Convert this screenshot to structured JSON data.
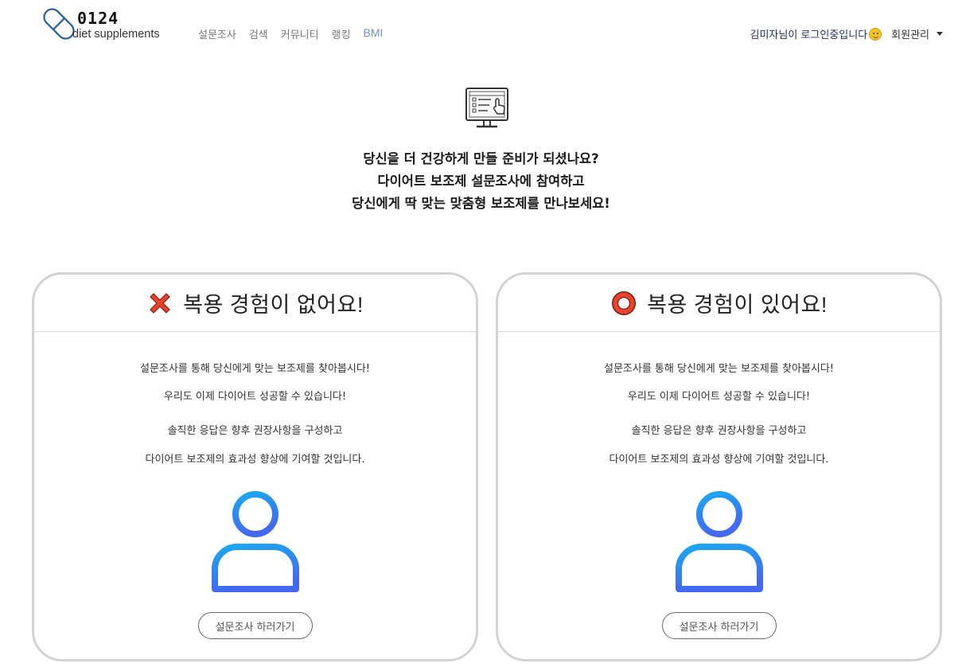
{
  "brand": {
    "number": "0124",
    "subtitle": "diet supplements",
    "icon": "pill-icon"
  },
  "nav": {
    "links": [
      {
        "label": "설문조사"
      },
      {
        "label": "검색"
      },
      {
        "label": "커뮤니티"
      },
      {
        "label": "랭킹"
      },
      {
        "label": "BMI"
      }
    ],
    "login_message": "김미자님이 로그인중입니다",
    "login_emoji": "smile-emoji",
    "member_menu": "회원관리"
  },
  "hero": {
    "icon": "survey-monitor-icon",
    "lines": [
      "당신을 더 건강하게 만들 준비가 되셨나요?",
      "다이어트 보조제 설문조사에 참여하고",
      "당신에게 딱 맞는 맞춤형 보조제를 만나보세요!"
    ]
  },
  "cards": [
    {
      "icon": "x-mark-icon",
      "title": "복용 경험이 없어요!",
      "lines": [
        "설문조사를 통해 당신에게 맞는 보조제를 찾아봅시다!",
        "우리도 이제 다이어트 성공할 수 있습니다!",
        "솔직한 응답은 향후 권장사항을 구성하고",
        "다이어트 보조제의 효과성 향상에 기여할 것입니다."
      ],
      "button": "설문조사 하러가기"
    },
    {
      "icon": "circle-mark-icon",
      "title": "복용 경험이 있어요!",
      "lines": [
        "설문조사를 통해 당신에게 맞는 보조제를 찾아봅시다!",
        "우리도 이제 다이어트 성공할 수 있습니다!",
        "솔직한 응답은 향후 권장사항을 구성하고",
        "다이어트 보조제의 효과성 향상에 기여할 것입니다."
      ],
      "button": "설문조사 하러가기"
    }
  ],
  "colors": {
    "nav_active": "#6d93c7",
    "login_text": "#1f2e5c",
    "user_icon_gradient": [
      "#1aa8f0",
      "#4468f0"
    ],
    "x_mark": "#e8432e",
    "circle_mark": "#e8432e",
    "card_border": "#d3d3d3"
  }
}
